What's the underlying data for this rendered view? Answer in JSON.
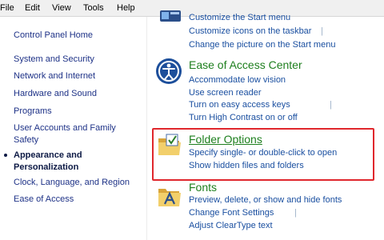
{
  "menubar": {
    "items": [
      "File",
      "Edit",
      "View",
      "Tools",
      "Help"
    ]
  },
  "sidebar": {
    "home": "Control Panel Home",
    "items": [
      "System and Security",
      "Network and Internet",
      "Hardware and Sound",
      "Programs",
      "User Accounts and Family",
      "Safety",
      "Appearance and",
      "Personalization",
      "Clock, Language, and Region",
      "Ease of Access"
    ]
  },
  "categories": {
    "taskbar": {
      "links": [
        "Customize the Start menu",
        "Customize icons on the taskbar",
        "Change the picture on the Start menu"
      ],
      "separator": "|"
    },
    "ease_of_access": {
      "title": "Ease of Access Center",
      "links": [
        "Accommodate low vision",
        "Use screen reader",
        "Turn on easy access keys",
        "Turn High Contrast on or off"
      ],
      "separator": "|"
    },
    "folder_options": {
      "title": "Folder Options",
      "links": [
        "Specify single- or double-click to open",
        "Show hidden files and folders"
      ]
    },
    "fonts": {
      "title": "Fonts",
      "links": [
        "Preview, delete, or show and hide fonts",
        "Change Font Settings",
        "Adjust ClearType text"
      ],
      "separator": "|"
    }
  },
  "colors": {
    "category_title": "#1e7f1e",
    "task_link": "#1a4fa0",
    "nav_link": "#1e3287",
    "highlight_border": "#e0272d"
  }
}
